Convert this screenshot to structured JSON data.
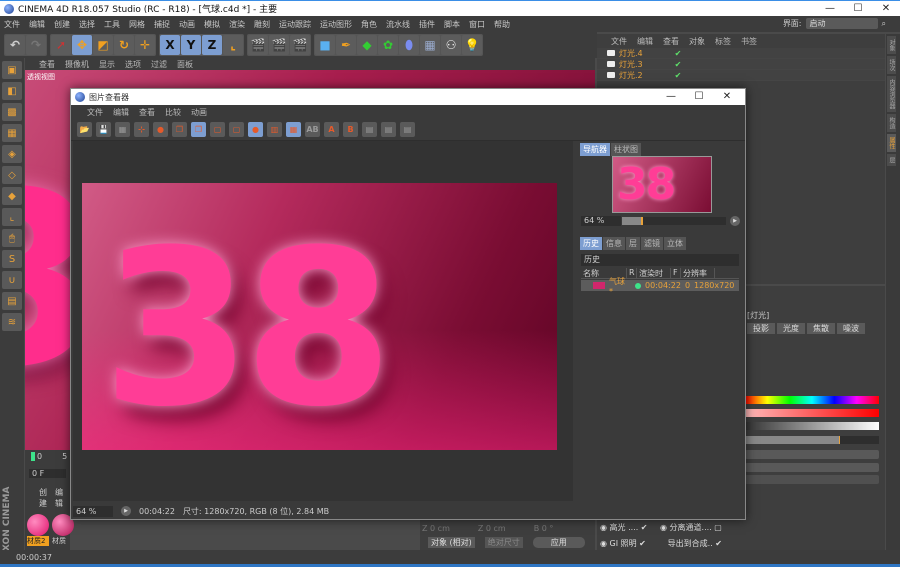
{
  "app": {
    "title": "CINEMA 4D R18.057 Studio (RC - R18) - [气球.c4d *] - 主要",
    "window_controls": [
      "—",
      "☐",
      "✕"
    ],
    "menu": [
      "文件",
      "编辑",
      "创建",
      "选择",
      "工具",
      "网格",
      "捕捉",
      "动画",
      "模拟",
      "渲染",
      "雕刻",
      "运动跟踪",
      "运动图形",
      "角色",
      "流水线",
      "插件",
      "脚本",
      "窗口",
      "帮助"
    ],
    "interface_label": "界面:",
    "interface_value": "启动"
  },
  "toolbar": {
    "icons": [
      "undo-icon",
      "redo-icon",
      "select-icon",
      "move-icon",
      "scale-icon",
      "rotate-icon",
      "recent-tool-icon",
      "x-axis-icon",
      "y-axis-icon",
      "z-axis-icon",
      "coordinate-system-icon",
      "render-view-icon",
      "render-picture-viewer-icon",
      "render-settings-icon",
      "cube-icon",
      "pen-icon",
      "subdivision-icon",
      "cloner-icon",
      "deformer-icon",
      "floor-icon",
      "camera-icon",
      "light-icon"
    ],
    "axis_labels": [
      "X",
      "Y",
      "Z"
    ]
  },
  "viewport": {
    "menu": [
      "查看",
      "摄像机",
      "显示",
      "选项",
      "过滤",
      "面板"
    ],
    "label": "透视视图",
    "render_text": "38"
  },
  "object_manager": {
    "menu": [
      "文件",
      "编辑",
      "查看",
      "对象",
      "标签",
      "书签"
    ],
    "objects": [
      "灯光.4",
      "灯光.3",
      "灯光.2"
    ]
  },
  "right_tabs": [
    "对象",
    "场次",
    "内容浏览器",
    "构造",
    "属性",
    "层"
  ],
  "attributes": {
    "heading": "[灯光]",
    "tabs": [
      "投影",
      "光度",
      "焦散",
      "噪波"
    ],
    "checkboxes": [
      {
        "label": "高光 ....",
        "checked": true
      },
      {
        "label": "分离通道....",
        "checked": false
      },
      {
        "label": "GI 照明",
        "checked": true
      },
      {
        "label": "导出到合成..",
        "checked": true
      }
    ]
  },
  "coordinates": {
    "z_pos": "0 cm",
    "z_size": "0 cm",
    "b_rot": "0 °",
    "mode": "对象 (相对)",
    "size_mode": "绝对尺寸",
    "apply": "应用"
  },
  "timeline": {
    "start": "0",
    "end": "5",
    "current_frame": "0 F"
  },
  "materials": {
    "menu": [
      "创建",
      "编辑"
    ],
    "items": [
      {
        "name": "材质2",
        "selected": true
      },
      {
        "name": "材质",
        "selected": false
      }
    ]
  },
  "status": {
    "time": "00:00:37"
  },
  "brand": "MAXON CINEMA 4D",
  "picture_viewer": {
    "title": "图片查看器",
    "menu": [
      "文件",
      "编辑",
      "查看",
      "比较",
      "动画"
    ],
    "image_text": "38",
    "nav_tabs": [
      "导航器",
      "柱状图"
    ],
    "zoom": "64 %",
    "zoom_progress": 0.2,
    "info_tabs": [
      "历史",
      "信息",
      "层",
      "滤镜",
      "立体"
    ],
    "history_title": "历史",
    "history_columns": [
      "名称",
      "R",
      "渲染时间",
      "F",
      "分辨率"
    ],
    "history_rows": [
      {
        "name": "气球 *",
        "render_time": "00:04:22",
        "frame": "0",
        "resolution": "1280x720"
      }
    ],
    "bottom_zoom": "64 %",
    "bottom_time": "00:04:22",
    "bottom_info": "尺寸: 1280x720, RGB (8 位), 2.84 MB"
  }
}
